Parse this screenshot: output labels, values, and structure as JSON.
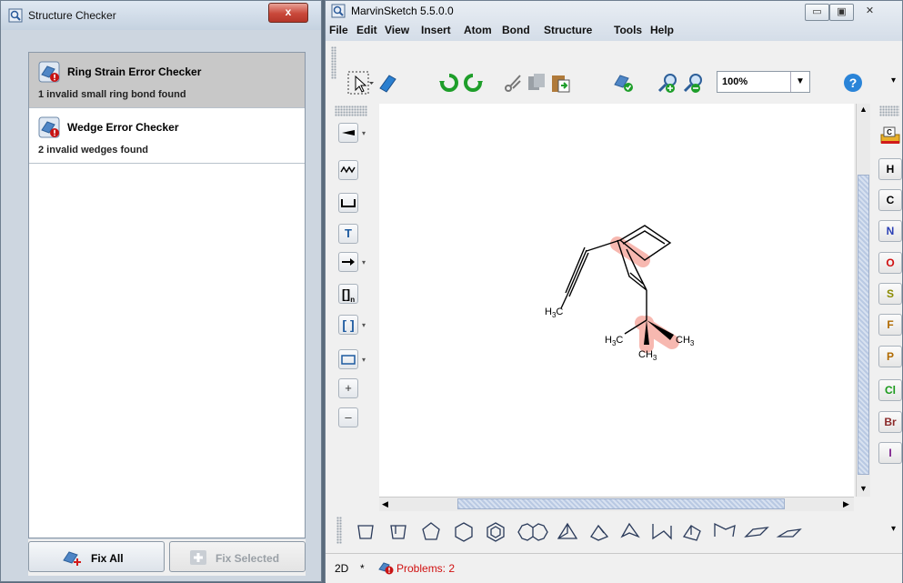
{
  "structure_checker": {
    "window_title": "Structure Checker",
    "close_label": "x",
    "checkers": [
      {
        "name": "Ring Strain Error Checker",
        "description": "1 invalid small ring bond found",
        "selected": true
      },
      {
        "name": "Wedge Error Checker",
        "description": "2 invalid wedges found",
        "selected": false
      }
    ],
    "fix_all_label": "Fix All",
    "fix_selected_label": "Fix Selected"
  },
  "marvinsketch": {
    "window_title": "MarvinSketch 5.5.0.0",
    "window_controls": {
      "minimize": "▭",
      "maximize": "▣",
      "close": "✕"
    },
    "menu": [
      "File",
      "Edit",
      "View",
      "Insert",
      "Atom",
      "Bond",
      "Structure",
      "Tools",
      "Help"
    ],
    "zoom": "100%",
    "left_tools": [
      "bond-tool",
      "chain-tool",
      "bracket-tool",
      "text-tool",
      "arrow-tool",
      "group-bracket-tool",
      "square-bracket-tool",
      "rectangle-tool",
      "plus-tool",
      "minus-tool"
    ],
    "left_tool_glyphs": {
      "text": "T",
      "group": "[]",
      "group_sub": "n",
      "bracket": "[ ]",
      "plus": "+",
      "minus": "–"
    },
    "atoms": [
      {
        "symbol": "H",
        "color": "#000000"
      },
      {
        "symbol": "C",
        "color": "#000000"
      },
      {
        "symbol": "N",
        "color": "#2b3fb5"
      },
      {
        "symbol": "O",
        "color": "#d01010"
      },
      {
        "symbol": "S",
        "color": "#8a8a00"
      },
      {
        "symbol": "F",
        "color": "#b06a00"
      },
      {
        "symbol": "P",
        "color": "#b06a00"
      },
      {
        "symbol": "Cl",
        "color": "#1a9a1a"
      },
      {
        "symbol": "Br",
        "color": "#8b2a2a"
      },
      {
        "symbol": "I",
        "color": "#7a1a8a"
      }
    ],
    "molecule_labels": {
      "h3c_left": "H",
      "h3c_left_sub": "3",
      "h3c_left_c": "C",
      "h3c_right": "H",
      "h3c_right_sub": "3",
      "h3c_right_c": "C",
      "ch3_right": "CH",
      "ch3_right_sub": "3",
      "ch3_bottom": "CH",
      "ch3_bottom_sub": "3"
    },
    "status": {
      "mode": "2D",
      "modified": "*",
      "problems": "Problems: 2"
    },
    "highlight_color": "#f7b8b0"
  }
}
